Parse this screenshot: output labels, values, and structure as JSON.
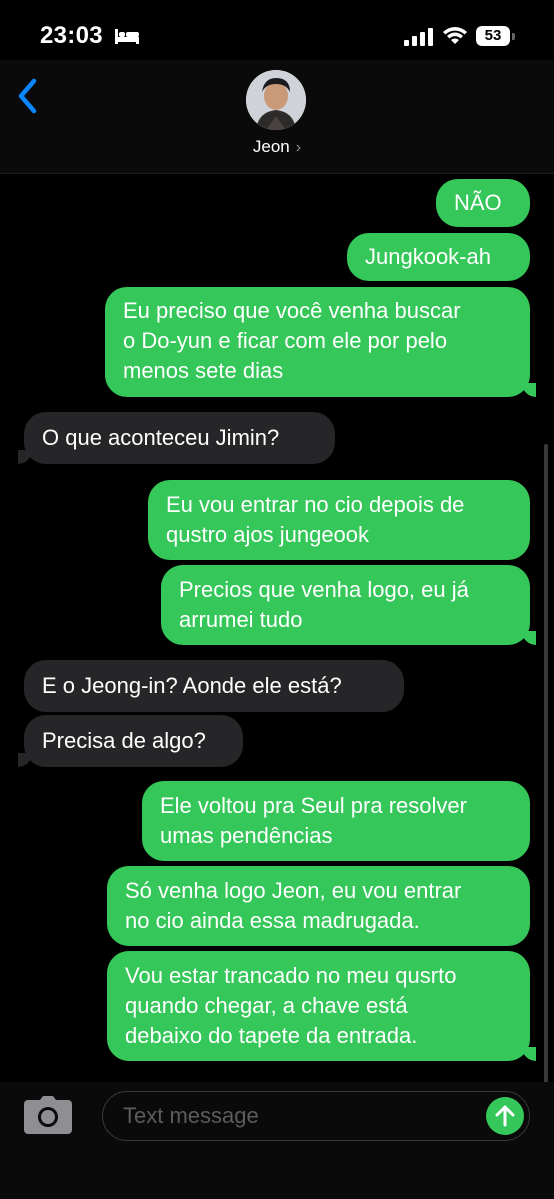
{
  "status_bar": {
    "time": "23:03",
    "battery": "53"
  },
  "header": {
    "contact_name": "Jeon",
    "chevron": "›"
  },
  "messages": [
    {
      "dir": "out",
      "lines": [
        "NÃO"
      ]
    },
    {
      "dir": "out",
      "lines": [
        "Jungkook-ah"
      ]
    },
    {
      "dir": "out",
      "lines": [
        "Eu preciso que você venha buscar",
        "o Do-yun e ficar com ele por pelo",
        "menos sete dias"
      ]
    },
    {
      "dir": "in",
      "lines": [
        "O que aconteceu Jimin?"
      ]
    },
    {
      "dir": "out",
      "lines": [
        "Eu vou entrar no cio depois de",
        "qustro ajos jungeook"
      ]
    },
    {
      "dir": "out",
      "lines": [
        "Precios que venha logo, eu já",
        "arrumei tudo"
      ]
    },
    {
      "dir": "in",
      "lines": [
        "E o Jeong-in? Aonde ele está?"
      ]
    },
    {
      "dir": "in",
      "lines": [
        "Precisa de algo?"
      ]
    },
    {
      "dir": "out",
      "lines": [
        "Ele voltou pra Seul pra resolver",
        "umas pendências"
      ]
    },
    {
      "dir": "out",
      "lines": [
        "Só venha logo Jeon, eu vou entrar",
        "no cio ainda essa madrugada."
      ]
    },
    {
      "dir": "out",
      "lines": [
        "Vou estar trancado no meu qusrto",
        "quando chegar, a chave está",
        "debaixo do tapete da entrada."
      ]
    }
  ],
  "composer": {
    "placeholder": "Text message"
  }
}
